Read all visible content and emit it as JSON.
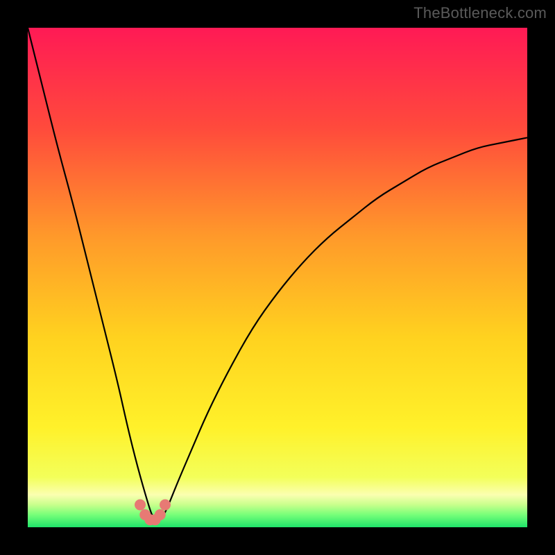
{
  "watermark": "TheBottleneck.com",
  "chart_data": {
    "type": "line",
    "title": "",
    "xlabel": "",
    "ylabel": "",
    "xlim": [
      0,
      100
    ],
    "ylim": [
      0,
      100
    ],
    "grid": false,
    "legend_position": "none",
    "series": [
      {
        "name": "curve",
        "x": [
          0,
          3,
          6,
          9,
          12,
          15,
          18,
          20,
          22,
          24,
          25,
          26,
          27,
          28,
          30,
          33,
          36,
          40,
          45,
          50,
          55,
          60,
          65,
          70,
          75,
          80,
          85,
          90,
          95,
          100
        ],
        "values": [
          100,
          88,
          76,
          65,
          53,
          41,
          29,
          20,
          12,
          5,
          2,
          1,
          2,
          4,
          9,
          16,
          23,
          31,
          40,
          47,
          53,
          58,
          62,
          66,
          69,
          72,
          74,
          76,
          77,
          78
        ]
      },
      {
        "name": "markers",
        "x": [
          22.5,
          23.5,
          24.5,
          25.5,
          26.5,
          27.5
        ],
        "values": [
          4.5,
          2.5,
          1.5,
          1.5,
          2.5,
          4.5
        ]
      }
    ],
    "background_gradient_stops": [
      {
        "offset": 0.0,
        "color": "#ff1a55"
      },
      {
        "offset": 0.2,
        "color": "#ff4a3c"
      },
      {
        "offset": 0.42,
        "color": "#ff9a2a"
      },
      {
        "offset": 0.62,
        "color": "#ffd21f"
      },
      {
        "offset": 0.8,
        "color": "#fff12a"
      },
      {
        "offset": 0.9,
        "color": "#f3ff5a"
      },
      {
        "offset": 0.935,
        "color": "#fbffb0"
      },
      {
        "offset": 0.955,
        "color": "#c8ff8c"
      },
      {
        "offset": 0.975,
        "color": "#77ff79"
      },
      {
        "offset": 1.0,
        "color": "#1fe46a"
      }
    ],
    "marker_color": "#e77a74",
    "curve_color": "#000000"
  }
}
